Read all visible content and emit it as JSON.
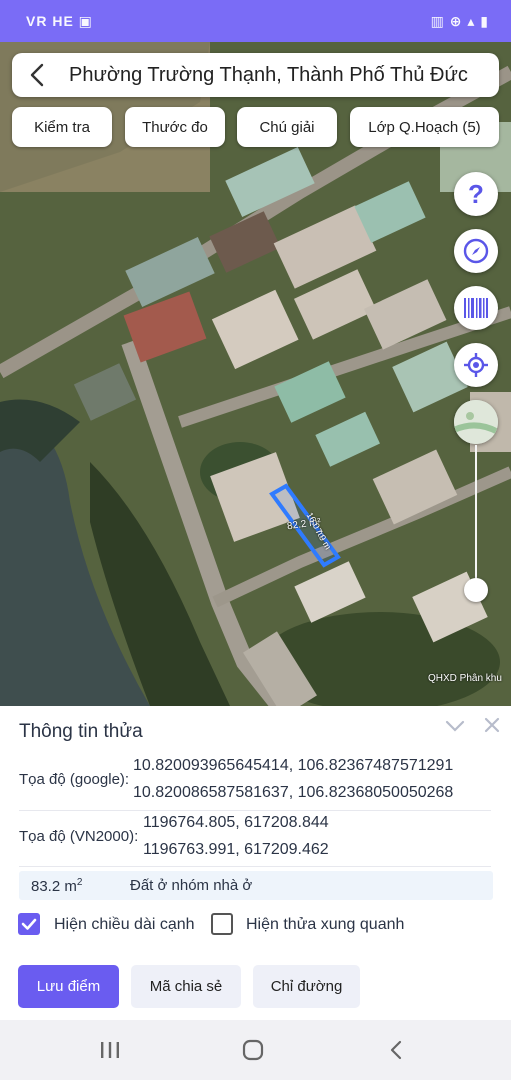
{
  "status_bar": {
    "left_text": "VR HE ▣",
    "right_text": "▥ ⊕ ▴ ▮"
  },
  "search": {
    "title": "Phường Trường Thạnh, Thành Phố Thủ Đức"
  },
  "toolbar": {
    "check_label": "Kiểm tra",
    "ruler_label": "Thước đo",
    "legend_label": "Chú giải",
    "layer_label": "Lớp Q.Hoạch (5)"
  },
  "map": {
    "parcel_area_label": "82.2 m²",
    "edge_label_1": "16.0 m",
    "edge_label_2": "7.9 m",
    "layer_caption": "QHXD Phân khu",
    "help_icon_glyph": "?",
    "accent_color": "#5a56e8",
    "parcel_outline_color": "#2f7bff"
  },
  "panel": {
    "title": "Thông tin thửa",
    "google_label": "Tọa độ (google):",
    "google_values": [
      "10.820093965645414, 106.82367487571291",
      "10.820086587581637, 106.82368050050268"
    ],
    "vn2000_label": "Tọa độ (VN2000):",
    "vn2000_values": [
      "1196764.805, 617208.844",
      "1196763.991, 617209.462"
    ],
    "area_value": "83.2 m",
    "area_unit_sup": "2",
    "land_type": "Đất ở nhóm nhà ở",
    "show_edge_length": {
      "label": "Hiện chiều dài cạnh",
      "checked": true
    },
    "show_surrounding": {
      "label": "Hiện thửa xung quanh",
      "checked": false
    },
    "actions": {
      "save": "Lưu điểm",
      "share": "Mã chia sẻ",
      "route": "Chỉ đường"
    }
  },
  "theme": {
    "primary": "#6a5cf0",
    "status_bar": "#7a6cf6"
  }
}
